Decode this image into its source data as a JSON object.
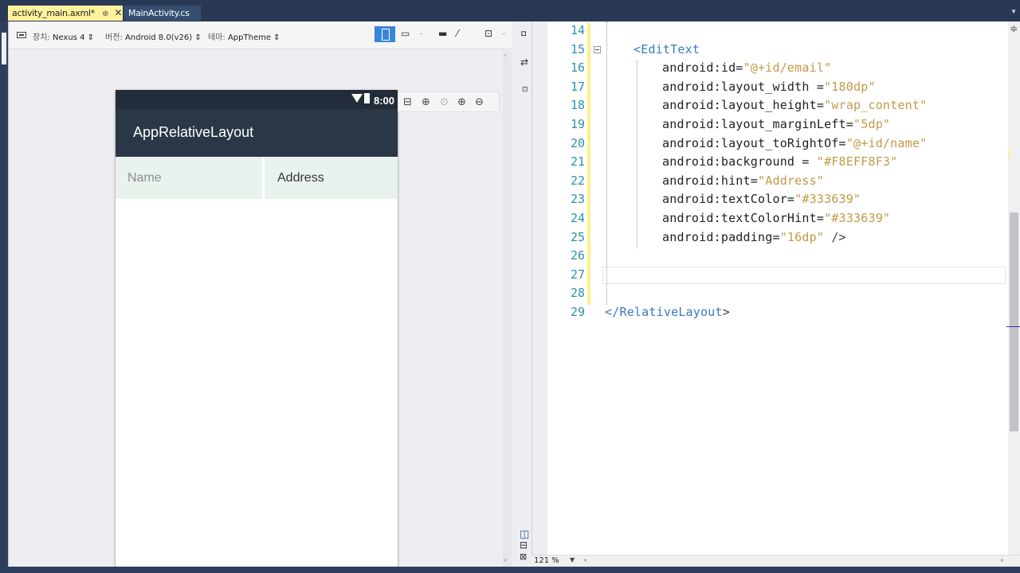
{
  "tabs": [
    {
      "label": "activity_main.axml*",
      "pin": "⊕",
      "close": "✕"
    },
    {
      "label": "MainActivity.cs"
    }
  ],
  "designer": {
    "device_label": "장치:",
    "device_value": "Nexus 4 ⇕",
    "version_label": "버전:",
    "version_value": "Android 8.0(v26) ⇕",
    "theme_label": "테마:",
    "theme_value": "AppTheme ⇕",
    "phone": {
      "time": "8:00",
      "app_title": "AppRelativeLayout",
      "name_hint": "Name",
      "address_hint": "Address"
    }
  },
  "editor": {
    "zoom": "121 %",
    "lines": [
      {
        "n": "14",
        "parts": []
      },
      {
        "n": "15",
        "parts": [
          {
            "t": "<",
            "c": "tag"
          },
          {
            "t": "EditText",
            "c": "tag"
          }
        ]
      },
      {
        "n": "16",
        "parts": [
          {
            "t": "android:id=",
            "c": "attr"
          },
          {
            "t": "\"@+id/email\"",
            "c": "str"
          }
        ]
      },
      {
        "n": "17",
        "parts": [
          {
            "t": "android:layout_width =",
            "c": "attr"
          },
          {
            "t": "\"180dp\"",
            "c": "str"
          }
        ]
      },
      {
        "n": "18",
        "parts": [
          {
            "t": "android:layout_height=",
            "c": "attr"
          },
          {
            "t": "\"wrap_content\"",
            "c": "str"
          }
        ]
      },
      {
        "n": "19",
        "parts": [
          {
            "t": "android:layout_marginLeft=",
            "c": "attr"
          },
          {
            "t": "\"5dp\"",
            "c": "str"
          }
        ]
      },
      {
        "n": "20",
        "parts": [
          {
            "t": "android:layout_toRightOf=",
            "c": "attr"
          },
          {
            "t": "\"@+id/name\"",
            "c": "str"
          }
        ]
      },
      {
        "n": "21",
        "parts": [
          {
            "t": "android:background = ",
            "c": "attr"
          },
          {
            "t": "\"#F8EFF8F3\"",
            "c": "str"
          }
        ]
      },
      {
        "n": "22",
        "parts": [
          {
            "t": "android:hint=",
            "c": "attr"
          },
          {
            "t": "\"Address\"",
            "c": "str"
          }
        ]
      },
      {
        "n": "23",
        "parts": [
          {
            "t": "android:textColor=",
            "c": "attr"
          },
          {
            "t": "\"#333639\"",
            "c": "str"
          }
        ]
      },
      {
        "n": "24",
        "parts": [
          {
            "t": "android:textColorHint=",
            "c": "attr"
          },
          {
            "t": "\"#333639\"",
            "c": "str"
          }
        ]
      },
      {
        "n": "25",
        "parts": [
          {
            "t": "android:padding=",
            "c": "attr"
          },
          {
            "t": "\"16dp\"",
            "c": "str"
          },
          {
            "t": " />",
            "c": "pun"
          }
        ]
      },
      {
        "n": "26",
        "parts": []
      },
      {
        "n": "27",
        "parts": []
      },
      {
        "n": "28",
        "parts": []
      },
      {
        "n": "29",
        "parts": [
          {
            "t": "</",
            "c": "tag"
          },
          {
            "t": "RelativeLayout",
            "c": "tag"
          },
          {
            "t": ">",
            "c": "pun"
          }
        ]
      }
    ]
  },
  "colors": {
    "accent_blue": "#3a85d8",
    "tab_active": "#fff29d",
    "appbar": "#2a3746",
    "edittext_bg": "#e9f3ed"
  }
}
